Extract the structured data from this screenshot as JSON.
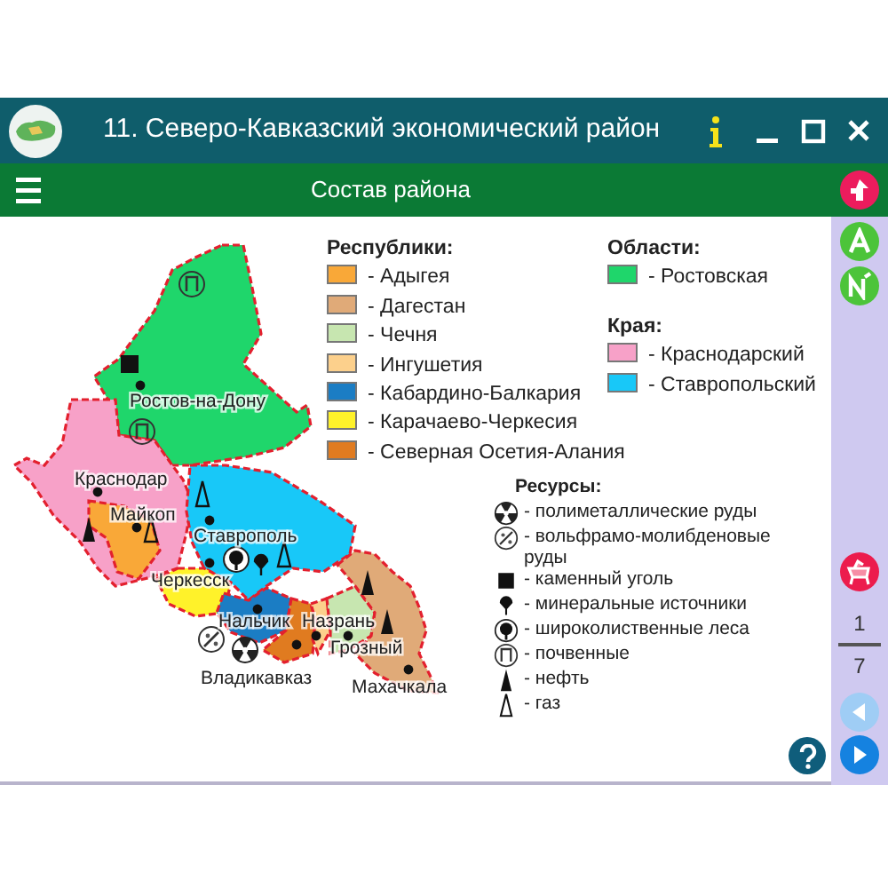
{
  "window": {
    "title": "11. Северо-Кавказский экономический район"
  },
  "toolbar": {
    "title": "Состав района"
  },
  "legend": {
    "republics": {
      "title": "Республики:",
      "items": [
        {
          "label": "- Адыгея",
          "color": "#f9a838"
        },
        {
          "label": "- Дагестан",
          "color": "#e0aa78"
        },
        {
          "label": "- Чечня",
          "color": "#c7e6b0"
        },
        {
          "label": "- Ингушетия",
          "color": "#fcd08c"
        },
        {
          "label": "- Кабардино-Балкария",
          "color": "#1b7dc4"
        },
        {
          "label": "- Карачаево-Черкесия",
          "color": "#fff22a"
        },
        {
          "label": "- Северная Осетия-Алания",
          "color": "#e07b20"
        }
      ]
    },
    "oblasti": {
      "title": "Области:",
      "items": [
        {
          "label": "- Ростовская",
          "color": "#1fd66b"
        }
      ]
    },
    "krai": {
      "title": "Края:",
      "items": [
        {
          "label": "- Краснодарский",
          "color": "#f7a1c8"
        },
        {
          "label": "- Ставропольский",
          "color": "#18c8f8"
        }
      ]
    },
    "resources": {
      "title": "Ресурсы:",
      "items": [
        {
          "kind": "polymetal",
          "label": "- полиметаллические руды"
        },
        {
          "kind": "tungsten",
          "label": "- вольфрамо-молибденовые руды"
        },
        {
          "kind": "coal",
          "label": "- каменный уголь"
        },
        {
          "kind": "mineral",
          "label": "- минеральные источники"
        },
        {
          "kind": "forest",
          "label": "- широколиственные леса"
        },
        {
          "kind": "soil",
          "label": "- почвенные"
        },
        {
          "kind": "oil",
          "label": "- нефть"
        },
        {
          "kind": "gas",
          "label": "- газ"
        }
      ]
    }
  },
  "map": {
    "cities": [
      "Ростов-на-Дону",
      "Краснодар",
      "Майкоп",
      "Ставрополь",
      "Черкесск",
      "Нальчик",
      "Назрань",
      "Грозный",
      "Владикавказ",
      "Махачкала"
    ]
  },
  "pager": {
    "current": "1",
    "total": "7"
  }
}
